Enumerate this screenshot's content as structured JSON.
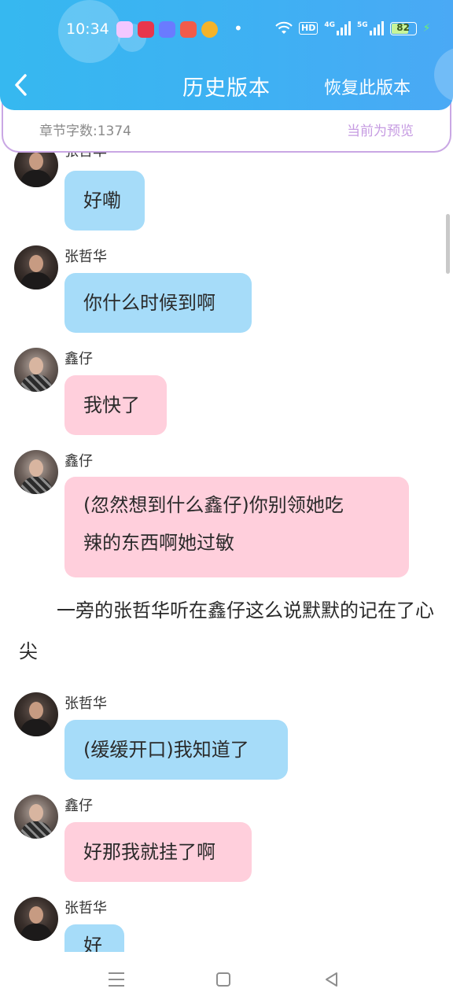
{
  "status_bar": {
    "time": "10:34",
    "app_icons": [
      {
        "name": "app-icon-1",
        "color": "#f3c7ff"
      },
      {
        "name": "app-icon-2",
        "color": "#e8364c"
      },
      {
        "name": "app-icon-3",
        "color": "#6a7bff"
      },
      {
        "name": "app-icon-4",
        "color": "#f25b4a"
      },
      {
        "name": "weibo-icon",
        "color": "#f4b32a"
      }
    ],
    "dot": "•",
    "wifi_icon": "wifi-icon",
    "hd_label": "HD",
    "net_4g": "4G",
    "net_5g": "5G",
    "battery": "82",
    "battery_level": 0.82
  },
  "header": {
    "back_icon": "‹",
    "title": "历史版本",
    "restore_button": "恢复此版本",
    "gradient_start": "#36b8f0",
    "gradient_end": "#4aa9f5"
  },
  "info_bar": {
    "word_count": "章节字数:1374",
    "preview_label": "当前为预览",
    "border_color": "#c9a7e4",
    "accent_color": "#c69be2"
  },
  "messages": [
    {
      "sender": "张哲华",
      "text": "好嘞",
      "bubble": "blue"
    },
    {
      "sender": "张哲华",
      "text": "你什么时候到啊",
      "bubble": "blue"
    },
    {
      "sender": "鑫仔",
      "text": "我快了",
      "bubble": "pink"
    },
    {
      "sender": "鑫仔",
      "text": "(忽然想到什么鑫仔)你别领她吃辣的东西啊她过敏",
      "line1": "(忽然想到什么鑫仔)你别领她吃",
      "line2": "辣的东西啊她过敏",
      "bubble": "pink"
    },
    {
      "sender": "张哲华",
      "text": "(缓缓开口)我知道了",
      "bubble": "blue"
    },
    {
      "sender": "鑫仔",
      "text": "好那我就挂了啊",
      "bubble": "pink"
    },
    {
      "sender": "张哲华",
      "text": "好",
      "bubble": "blue"
    }
  ],
  "narration": "一旁的张哲华听在鑫仔这么说默默的记在了心尖",
  "colors": {
    "blue_bubble": "#a6dcf9",
    "pink_bubble": "#ffcfdc"
  },
  "nav_bar": {
    "menu_icon": "menu-icon",
    "home_icon": "home-icon",
    "back_icon": "back-triangle-icon"
  }
}
